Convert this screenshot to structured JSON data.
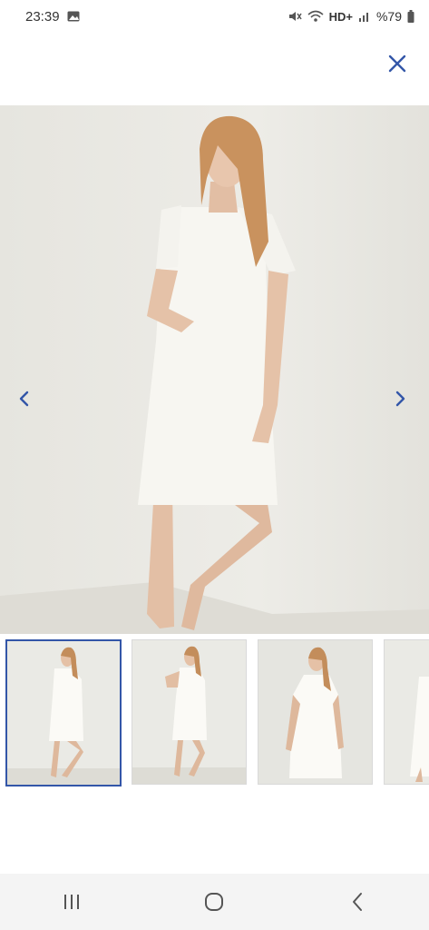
{
  "status_bar": {
    "time": "23:39",
    "network": "HD+",
    "battery": "%79"
  },
  "icons": {
    "close": "close-icon",
    "prev": "chevron-left-icon",
    "next": "chevron-right-icon",
    "recents": "recents-icon",
    "home": "home-icon",
    "back": "back-icon"
  },
  "colors": {
    "accent": "#3356a8",
    "photo_bg": "#e9e8e3",
    "dress": "#f7f6f1"
  },
  "gallery": {
    "image_count_visible": 4,
    "selected_index": 0
  }
}
